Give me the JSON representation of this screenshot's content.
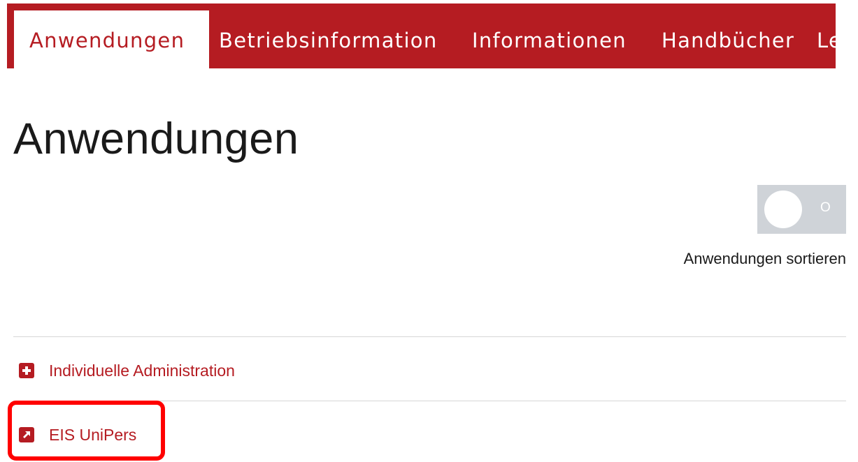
{
  "nav": {
    "tabs": [
      {
        "label": "Anwendungen",
        "active": true
      },
      {
        "label": "Betriebsinformation",
        "active": false
      },
      {
        "label": "Informationen",
        "active": false
      },
      {
        "label": "Handbücher",
        "active": false
      },
      {
        "label": "Le",
        "active": false
      }
    ]
  },
  "page": {
    "title": "Anwendungen"
  },
  "sort": {
    "toggle_state_text": "O",
    "label": "Anwendungen sortieren"
  },
  "apps": [
    {
      "label": "Individuelle Administration",
      "icon": "plus-square-icon"
    },
    {
      "label": "EIS UniPers",
      "icon": "external-link-icon"
    }
  ],
  "colors": {
    "brand_red": "#b51c22",
    "toggle_gray": "#cfd3d8",
    "highlight_red": "#ff0000"
  }
}
